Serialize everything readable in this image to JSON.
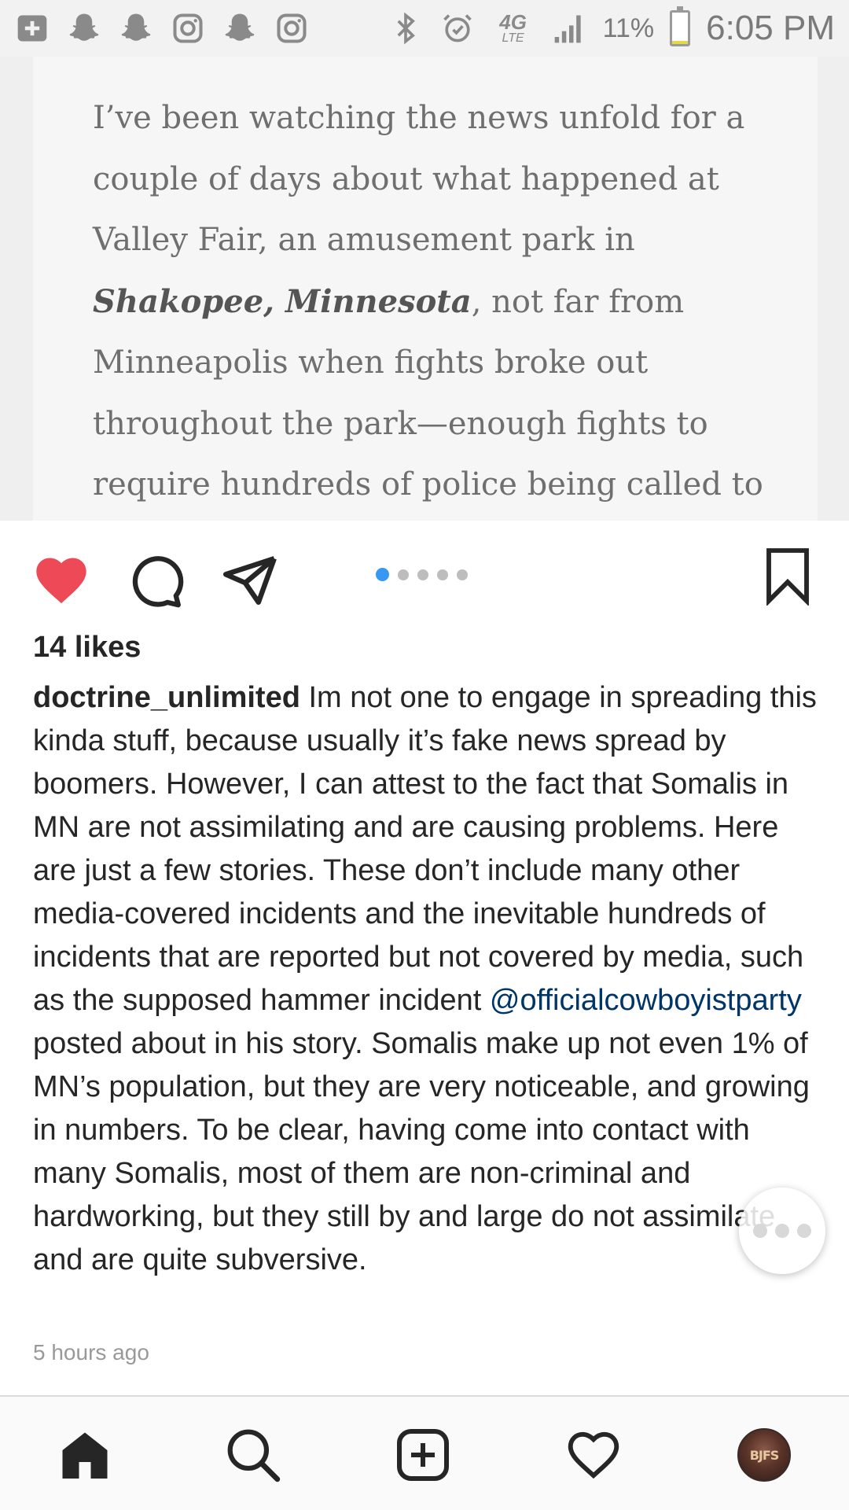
{
  "status_bar": {
    "icons_left": [
      "add-box-icon",
      "snapchat-icon",
      "snapchat-icon",
      "instagram-icon",
      "snapchat-icon",
      "instagram-icon"
    ],
    "icons_right": [
      "bluetooth-icon",
      "alarm-icon",
      "4g-lte-icon",
      "signal-icon"
    ],
    "network": "4G",
    "network_sub": "LTE",
    "battery_percent": "11%",
    "battery_level": 0.11,
    "time": "6:05 PM"
  },
  "post_image": {
    "lines": [
      "I’ve been watching the news unfold for a",
      "couple of days about what happened at",
      "Valley Fair, an amusement park in",
      "",
      "Minneapolis when fights broke out",
      "throughout the park—enough fights to",
      "require hundreds of police being called to"
    ],
    "line4_bold": "Shakopee, Minnesota",
    "line4_rest": ", not far from"
  },
  "carousel": {
    "count": 5,
    "active_index": 0
  },
  "colors": {
    "like": "#ed4956",
    "active_dot": "#3897f0",
    "mention": "#003569"
  },
  "post": {
    "likes": "14 likes",
    "username": "doctrine_unlimited",
    "caption_part1": " Im not one to engage in spreading this kinda stuff, because usually it’s fake news spread by boomers. However, I can attest to the fact that Somalis in MN are not assimilating and are causing problems. Here are just a few stories. These don’t include many other media-covered incidents and the inevitable hundreds of incidents that are reported but not covered by media, such as the supposed hammer incident ",
    "mention": "@officialcowboyistparty",
    "caption_part2": " posted about in his story. Somalis make up not even 1% of MN’s population, but they are very noticeable, and growing in numbers. To be clear, having come into contact with many Somalis, most of them are non-criminal and hardworking, but they still by and large do not assimilate and are quite subversive.",
    "timestamp": "5 hours ago"
  },
  "bottom_nav": {
    "items": [
      "home-icon",
      "search-icon",
      "add-post-icon",
      "activity-heart-icon",
      "profile-avatar"
    ],
    "avatar_text": "BJFS"
  }
}
